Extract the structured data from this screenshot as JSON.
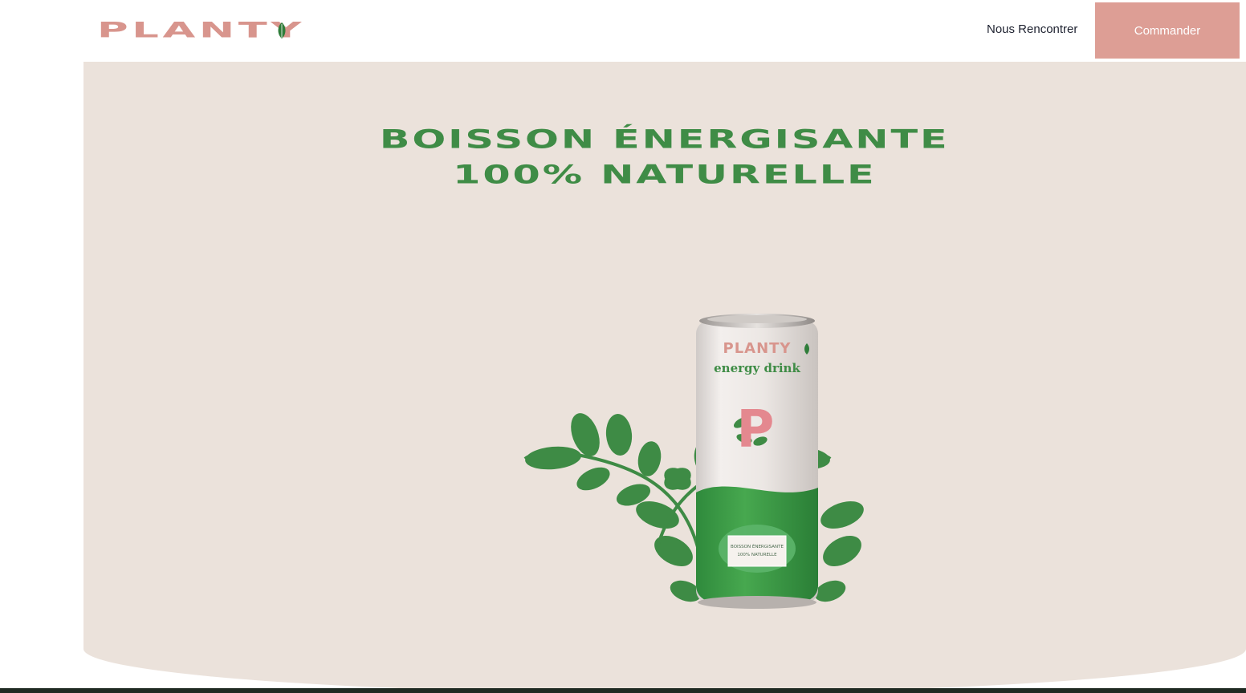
{
  "header": {
    "logo_text": "PLANTY",
    "nav_link": "Nous Rencontrer",
    "cta_label": "Commander"
  },
  "hero": {
    "title_line1": "BOISSON ÉNERGISANTE",
    "title_line2": "100% NATURELLE"
  },
  "product": {
    "brand": "PLANTY",
    "subtitle": "energy drink",
    "monogram": "P",
    "label_line1": "BOISSON ÉNERGISANTE",
    "label_line2": "100% NATURELLE"
  },
  "colors": {
    "brand_pink": "#d8958d",
    "cta_background": "#dd9e95",
    "accent_green": "#3f8c46",
    "hero_background": "#ebe2db"
  },
  "icons": [
    "leaf-icon",
    "leaf-branch-left",
    "leaf-branch-right"
  ]
}
